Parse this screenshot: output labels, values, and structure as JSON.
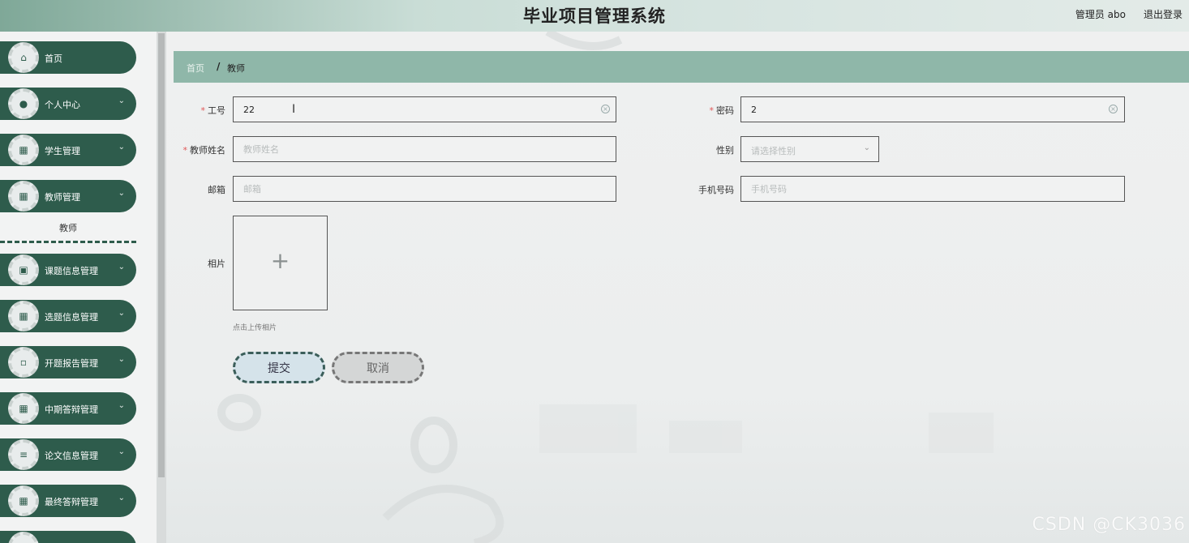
{
  "header": {
    "title": "毕业项目管理系统",
    "user": "管理员 abo",
    "logout": "退出登录"
  },
  "sidebar": {
    "items": [
      {
        "label": "首页",
        "icon": "home-icon",
        "has_chevron": false
      },
      {
        "label": "个人中心",
        "icon": "user-icon",
        "has_chevron": true
      },
      {
        "label": "学生管理",
        "icon": "grid-icon",
        "has_chevron": true
      },
      {
        "label": "教师管理",
        "icon": "grid-icon",
        "has_chevron": true
      },
      {
        "label": "课题信息管理",
        "icon": "clipboard-icon",
        "has_chevron": true
      },
      {
        "label": "选题信息管理",
        "icon": "grid-icon",
        "has_chevron": true
      },
      {
        "label": "开题报告管理",
        "icon": "message-icon",
        "has_chevron": true
      },
      {
        "label": "中期答辩管理",
        "icon": "grid-icon",
        "has_chevron": true
      },
      {
        "label": "论文信息管理",
        "icon": "list-icon",
        "has_chevron": true
      },
      {
        "label": "最终答辩管理",
        "icon": "grid-icon",
        "has_chevron": true
      }
    ],
    "submenu_active": "教师"
  },
  "breadcrumb": {
    "home": "首页",
    "separator": "/",
    "current": "教师"
  },
  "form": {
    "job_no": {
      "label": "工号",
      "value": "22"
    },
    "password": {
      "label": "密码",
      "value": "2"
    },
    "name": {
      "label": "教师姓名",
      "placeholder": "教师姓名"
    },
    "gender": {
      "label": "性别",
      "placeholder": "请选择性别"
    },
    "email": {
      "label": "邮箱",
      "placeholder": "邮箱"
    },
    "phone": {
      "label": "手机号码",
      "placeholder": "手机号码"
    },
    "photo": {
      "label": "相片",
      "hint": "点击上传相片"
    },
    "submit": "提交",
    "cancel": "取消"
  },
  "watermark": "CSDN @CK3036",
  "colors": {
    "sidebar_item": "#2e5c4c",
    "breadcrumb_bg": "#8fb7a9",
    "required": "#e05656"
  }
}
